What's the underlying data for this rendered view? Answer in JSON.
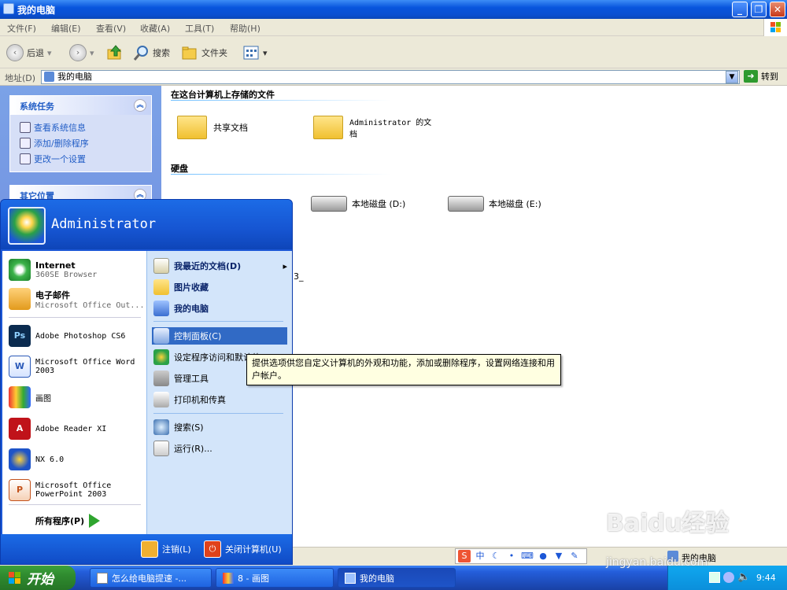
{
  "window": {
    "title": "我的电脑"
  },
  "menubar": {
    "items": [
      "文件(F)",
      "编辑(E)",
      "查看(V)",
      "收藏(A)",
      "工具(T)",
      "帮助(H)"
    ]
  },
  "toolbar": {
    "back": "后退",
    "search": "搜索",
    "folders": "文件夹"
  },
  "address": {
    "label": "地址(D)",
    "value": "我的电脑",
    "go": "转到"
  },
  "tasks": {
    "system_title": "系统任务",
    "system_items": [
      "查看系统信息",
      "添加/删除程序",
      "更改一个设置"
    ],
    "other_title": "其它位置"
  },
  "content": {
    "section_files": "在这台计算机上存储的文件",
    "shared_docs": "共享文档",
    "admin_docs": "Administrator 的文档",
    "section_drives": "硬盘",
    "drive_d": "本地磁盘 (D:)",
    "drive_e": "本地磁盘 (E:)",
    "partial_text": "3_"
  },
  "startmenu": {
    "user": "Administrator",
    "pinned": [
      {
        "title": "Internet",
        "sub": "360SE Browser"
      },
      {
        "title": "电子邮件",
        "sub": "Microsoft Office Out..."
      }
    ],
    "recent": [
      "Adobe Photoshop CS6",
      "Microsoft Office Word 2003",
      "画图",
      "Adobe Reader XI",
      "NX 6.0",
      "Microsoft Office PowerPoint 2003"
    ],
    "all_programs": "所有程序(P)",
    "right": [
      "我最近的文档(D)",
      "图片收藏",
      "我的电脑",
      "控制面板(C)",
      "设定程序访问和默认值",
      "管理工具",
      "打印机和传真",
      "搜索(S)",
      "运行(R)..."
    ],
    "logoff": "注销(L)",
    "shutdown": "关闭计算机(U)"
  },
  "tooltip": "提供选项供您自定义计算机的外观和功能，添加或删除程序，设置网络连接和用户帐户。",
  "statusbar": {
    "location": "我的电脑"
  },
  "langbar": {
    "ime": "中"
  },
  "taskbar": {
    "start": "开始",
    "buttons": [
      "怎么给电脑提速 -...",
      "8 - 画图",
      "我的电脑"
    ],
    "clock": "9:44"
  },
  "watermark": {
    "brand": "Baidu经验",
    "url": "jingyan.baidu.com"
  },
  "colors": {
    "title_blue": "#0855dd",
    "start_green": "#2f8b2f",
    "highlight": "#316ac5",
    "tooltip_bg": "#ffffe1"
  }
}
